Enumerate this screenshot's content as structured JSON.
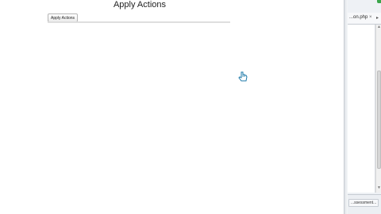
{
  "page": {
    "title": "Apply Actions",
    "apply_button_label": "Apply Actions"
  },
  "side_panel": {
    "tab_label": "...on.php",
    "tab_close": "×",
    "tab_menu": "▸",
    "bottom_label": "...ssessment..."
  },
  "icons": {
    "cursor": "hand-pointer-icon",
    "scroll_up": "arrow-up-icon",
    "scroll_down": "arrow-down-icon"
  },
  "colors": {
    "indicator": "#3aa54a",
    "cursor": "#1e7aa8"
  }
}
